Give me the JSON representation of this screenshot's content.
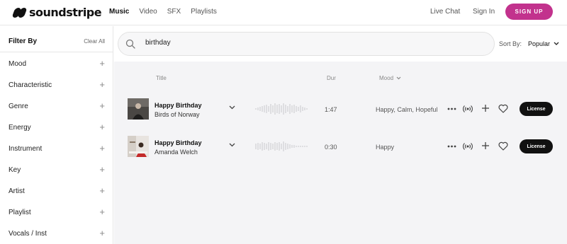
{
  "header": {
    "logo_text": "soundstripe",
    "nav": [
      {
        "label": "Music",
        "active": true
      },
      {
        "label": "Video",
        "active": false
      },
      {
        "label": "SFX",
        "active": false
      },
      {
        "label": "Playlists",
        "active": false
      }
    ],
    "live_chat": "Live Chat",
    "sign_in": "Sign In",
    "sign_up": "SIGN UP",
    "accent_color": "#c2328d"
  },
  "sidebar": {
    "title": "Filter By",
    "clear_all": "Clear All",
    "filters": [
      "Mood",
      "Characteristic",
      "Genre",
      "Energy",
      "Instrument",
      "Key",
      "Artist",
      "Playlist",
      "Vocals / Inst"
    ]
  },
  "search": {
    "value": "birthday",
    "sort_label": "Sort By:",
    "sort_value": "Popular"
  },
  "results": {
    "columns": {
      "title": "Title",
      "duration": "Dur",
      "mood": "Mood"
    },
    "tracks": [
      {
        "title": "Happy Birthday",
        "artist": "Birds of Norway",
        "duration": "1:47",
        "mood": "Happy, Calm, Hopeful",
        "license": "License"
      },
      {
        "title": "Happy Birthday",
        "artist": "Amanda Welch",
        "duration": "0:30",
        "mood": "Happy",
        "license": "License"
      }
    ]
  },
  "icons": [
    "search-icon",
    "chevron-down-icon",
    "plus-icon",
    "more-icon",
    "broadcast-icon",
    "heart-icon"
  ]
}
